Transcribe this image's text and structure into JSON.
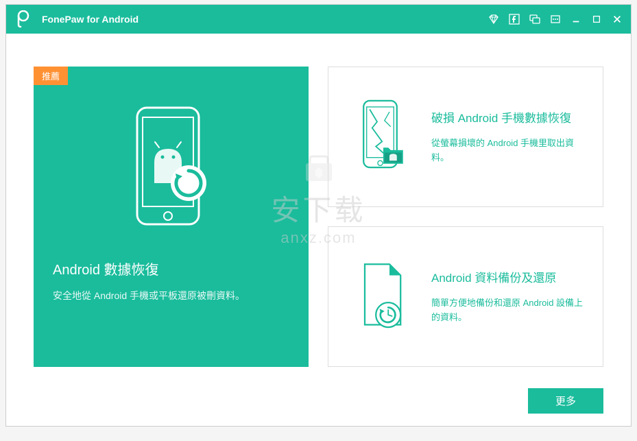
{
  "app": {
    "title": "FonePaw for Android"
  },
  "mainCard": {
    "badge": "推薦",
    "title": "Android 數據恢復",
    "description": "安全地從 Android 手機或平板還原被刪資料。"
  },
  "sideCards": [
    {
      "title": "破損 Android 手機數據恢復",
      "description": "從螢幕損壞的 Android 手機里取出資料。"
    },
    {
      "title": "Android 資料備份及還原",
      "description": "簡單方便地備份和還原 Android 設備上的資料。"
    }
  ],
  "buttons": {
    "more": "更多"
  },
  "watermark": {
    "main": "安下载",
    "sub": "anxz.com"
  },
  "colors": {
    "primary": "#1abc9c",
    "badge": "#ff9133"
  }
}
